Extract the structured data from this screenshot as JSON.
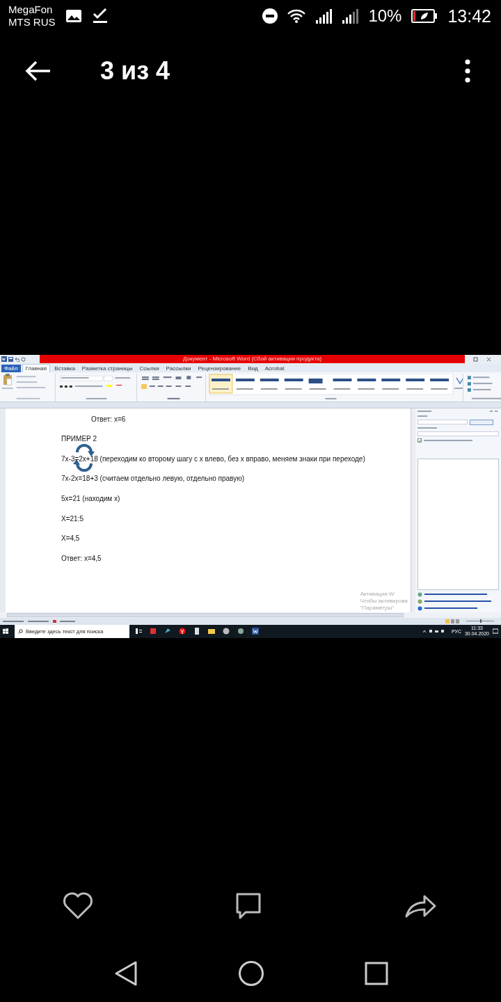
{
  "status_bar": {
    "carriers": [
      "MegaFon",
      "MTS RUS"
    ],
    "battery": "10%",
    "time": "13:42"
  },
  "app_bar": {
    "title": "3 из 4"
  },
  "word": {
    "title": "Документ - Microsoft Word (Сбой активации продукта)",
    "tabs": [
      {
        "label": "Файл",
        "selected": false,
        "kind": "file"
      },
      {
        "label": "Главная",
        "selected": true,
        "kind": "tab"
      },
      {
        "label": "Вставка",
        "selected": false,
        "kind": "tab"
      },
      {
        "label": "Разметка страницы",
        "selected": false,
        "kind": "tab"
      },
      {
        "label": "Ссылки",
        "selected": false,
        "kind": "tab"
      },
      {
        "label": "Рассылки",
        "selected": false,
        "kind": "tab"
      },
      {
        "label": "Рецензирование",
        "selected": false,
        "kind": "tab"
      },
      {
        "label": "Вид",
        "selected": false,
        "kind": "tab"
      },
      {
        "label": "Acrobat",
        "selected": false,
        "kind": "tab"
      }
    ],
    "document": {
      "lines": [
        {
          "text": "Ответ: x=6",
          "kind": "indented"
        },
        {
          "text": "ПРИМЕР 2",
          "kind": "plain"
        },
        {
          "text": "7x-3=2x+18 (переходим ко второму шагу с х влево, без х вправо, меняем знаки при переходе)",
          "kind": "plain"
        },
        {
          "text": "7x-2x=18+3 (считаем отдельно левую, отдельно правую)",
          "kind": "plain"
        },
        {
          "text": "5x=21 (находим х)",
          "kind": "plain"
        },
        {
          "text": "X=21:5",
          "kind": "plain"
        },
        {
          "text": "X=4,5",
          "kind": "plain"
        },
        {
          "text": "Ответ: x=4,5",
          "kind": "plain"
        }
      ]
    },
    "activation": [
      "Активация W",
      "Чтобы активирова",
      "\"Параметры\"."
    ],
    "clip_art_pane": {
      "include_bing_checked": true
    },
    "status": {
      "zoom_level": {
        "level": 0.5
      }
    },
    "taskbar": {
      "search_placeholder": "Введите здесь текст для поиска",
      "language": "РУС",
      "time": "11:33",
      "date": "30.04.2020"
    }
  }
}
